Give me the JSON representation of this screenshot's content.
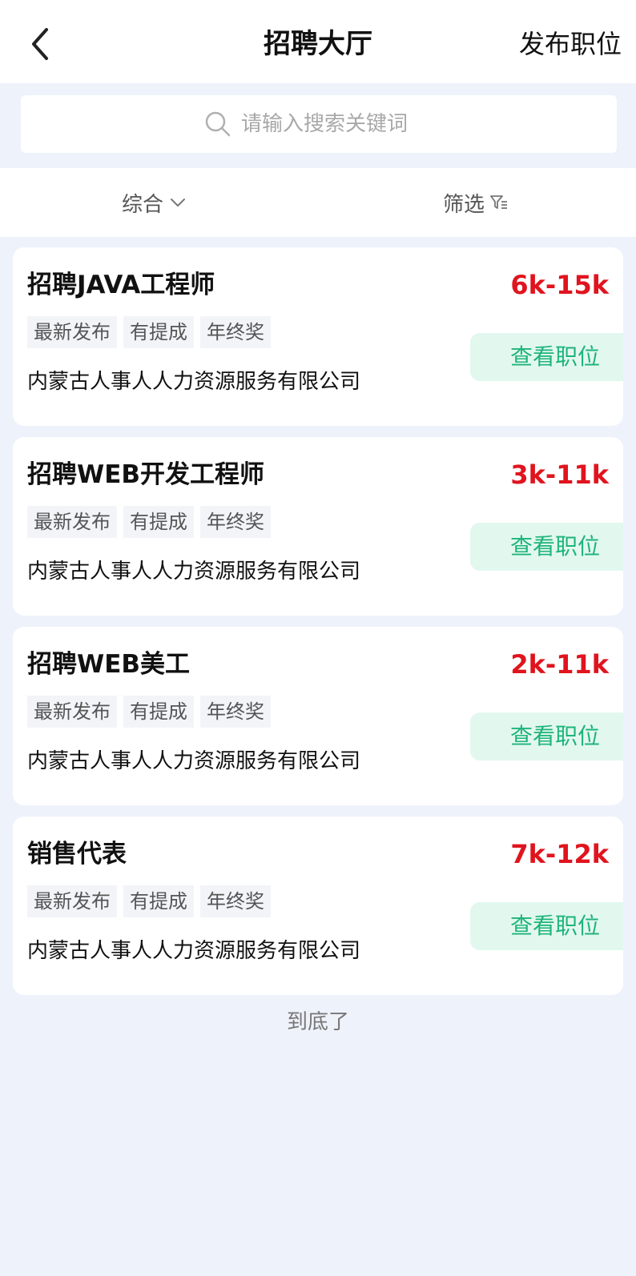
{
  "header": {
    "title": "招聘大厅",
    "publish_label": "发布职位"
  },
  "search": {
    "placeholder": "请输入搜索关键词"
  },
  "filter_bar": {
    "sort_label": "综合",
    "filter_label": "筛选"
  },
  "jobs": [
    {
      "title": "招聘JAVA工程师",
      "salary": "6k-15k",
      "tags": [
        "最新发布",
        "有提成",
        "年终奖"
      ],
      "company": "内蒙古人事人人力资源服务有限公司",
      "view_label": "查看职位"
    },
    {
      "title": "招聘WEB开发工程师",
      "salary": "3k-11k",
      "tags": [
        "最新发布",
        "有提成",
        "年终奖"
      ],
      "company": "内蒙古人事人人力资源服务有限公司",
      "view_label": "查看职位"
    },
    {
      "title": "招聘WEB美工",
      "salary": "2k-11k",
      "tags": [
        "最新发布",
        "有提成",
        "年终奖"
      ],
      "company": "内蒙古人事人人力资源服务有限公司",
      "view_label": "查看职位"
    },
    {
      "title": "销售代表",
      "salary": "7k-12k",
      "tags": [
        "最新发布",
        "有提成",
        "年终奖"
      ],
      "company": "内蒙古人事人人力资源服务有限公司",
      "view_label": "查看职位"
    }
  ],
  "footer": {
    "end_text": "到底了"
  },
  "colors": {
    "background": "#eef2fb",
    "salary": "#e0141e",
    "view_button_text": "#1fb47a",
    "view_button_bg": "#e2f8ef"
  },
  "icons": {
    "back": "back-arrow-icon",
    "search": "search-icon",
    "sort": "chevron-down-icon",
    "filter": "filter-icon"
  }
}
